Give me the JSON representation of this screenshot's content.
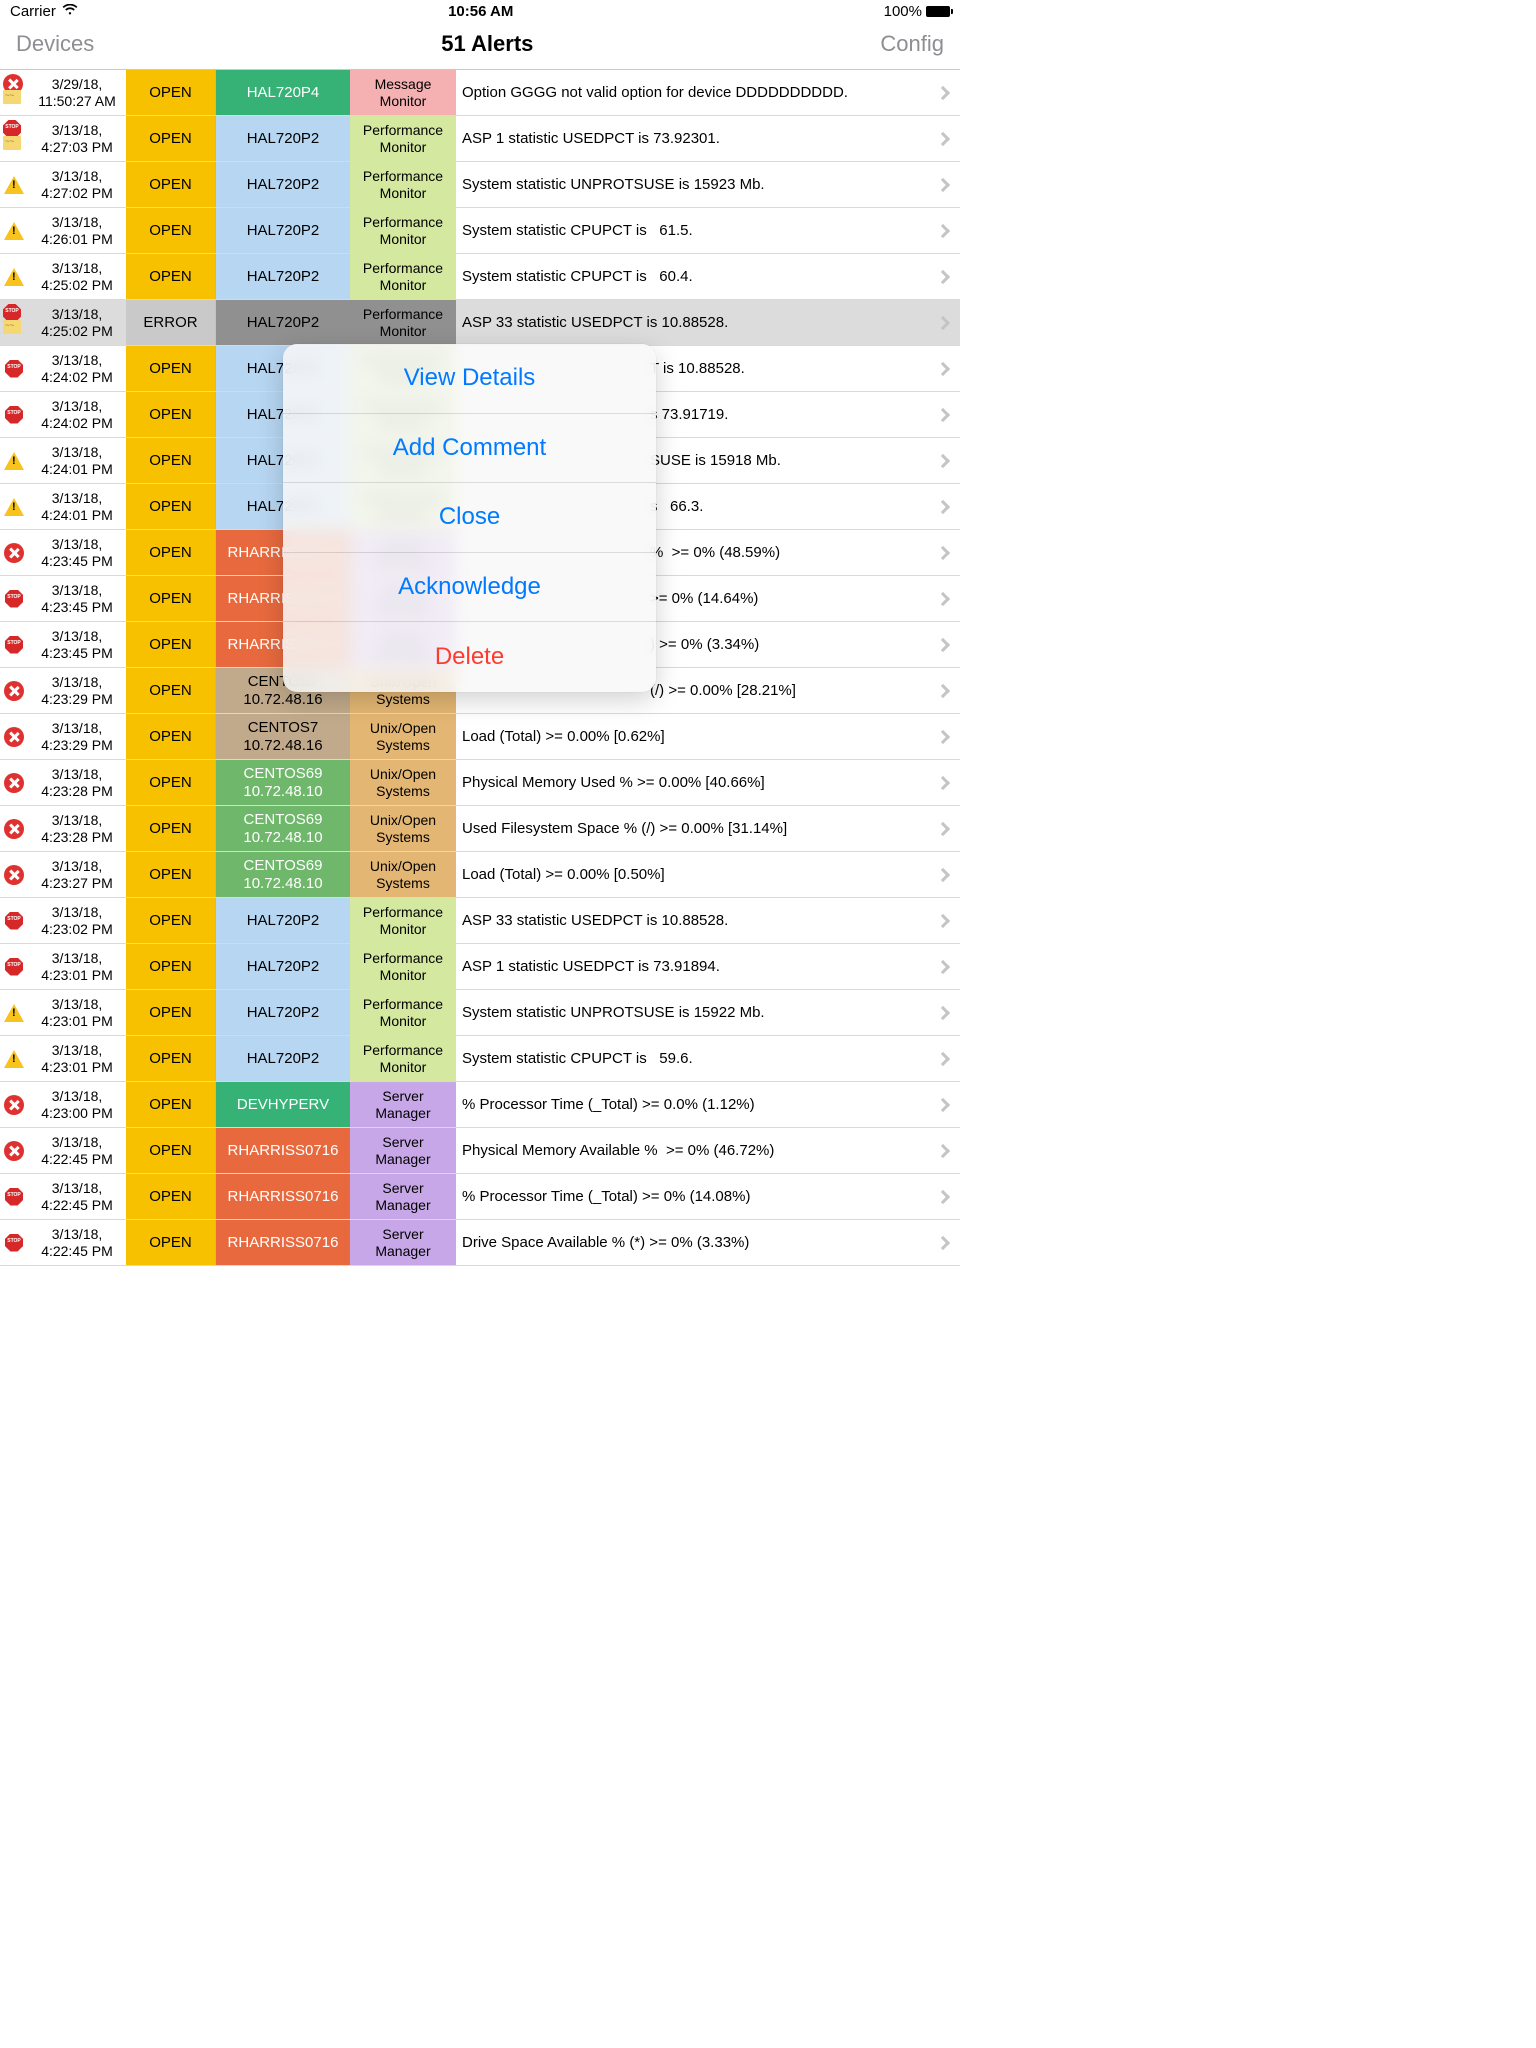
{
  "status_bar": {
    "carrier": "Carrier",
    "time": "10:56 AM",
    "battery": "100%"
  },
  "nav": {
    "left": "Devices",
    "title": "51 Alerts",
    "right": "Config"
  },
  "sheet": {
    "view_details": "View Details",
    "add_comment": "Add Comment",
    "close": "Close",
    "acknowledge": "Acknowledge",
    "delete": "Delete"
  },
  "rows": [
    {
      "icons": [
        "error",
        "note"
      ],
      "date": "3/29/18,",
      "time": "11:50:27 AM",
      "status": "OPEN",
      "sc": "yellow",
      "host": "HAL720P4",
      "hc": "green",
      "mon": "Message Monitor",
      "mc": "pink",
      "msg": "Option GGGG not valid option for device DDDDDDDDDD."
    },
    {
      "icons": [
        "stop",
        "note"
      ],
      "date": "3/13/18,",
      "time": "4:27:03 PM",
      "status": "OPEN",
      "sc": "yellow",
      "host": "HAL720P2",
      "hc": "lblue",
      "mon": "Performance Monitor",
      "mc": "pgreen",
      "msg": "ASP 1 statistic USEDPCT is 73.92301."
    },
    {
      "icons": [
        "warn"
      ],
      "date": "3/13/18,",
      "time": "4:27:02 PM",
      "status": "OPEN",
      "sc": "yellow",
      "host": "HAL720P2",
      "hc": "lblue",
      "mon": "Performance Monitor",
      "mc": "pgreen",
      "msg": "System statistic UNPROTSUSE is 15923 Mb."
    },
    {
      "icons": [
        "warn"
      ],
      "date": "3/13/18,",
      "time": "4:26:01 PM",
      "status": "OPEN",
      "sc": "yellow",
      "host": "HAL720P2",
      "hc": "lblue",
      "mon": "Performance Monitor",
      "mc": "pgreen",
      "msg": "System statistic CPUPCT is   61.5."
    },
    {
      "icons": [
        "warn"
      ],
      "date": "3/13/18,",
      "time": "4:25:02 PM",
      "status": "OPEN",
      "sc": "yellow",
      "host": "HAL720P2",
      "hc": "lblue",
      "mon": "Performance Monitor",
      "mc": "pgreen",
      "msg": "System statistic CPUPCT is   60.4."
    },
    {
      "icons": [
        "stop",
        "note"
      ],
      "date": "3/13/18,",
      "time": "4:25:02 PM",
      "status": "ERROR",
      "sc": "errgray",
      "host": "HAL720P2",
      "hc": "gray",
      "mon": "Performance Monitor",
      "mc": "gray",
      "msg": "ASP 33 statistic USEDPCT is 10.88528.",
      "rowc": "error"
    },
    {
      "icons": [
        "stop"
      ],
      "date": "3/13/18,",
      "time": "4:24:02 PM",
      "status": "OPEN",
      "sc": "yellow",
      "host": "HAL720P2",
      "hc": "lblue",
      "mon": "Performance Monitor",
      "mc": "pgreen",
      "msg": "T is 10.88528.",
      "msgpad": true
    },
    {
      "icons": [
        "stop"
      ],
      "date": "3/13/18,",
      "time": "4:24:02 PM",
      "status": "OPEN",
      "sc": "yellow",
      "host": "HAL720P2",
      "hc": "lblue",
      "mon": "Performance Monitor",
      "mc": "pgreen",
      "msg": "s 73.91719.",
      "msgpad": true
    },
    {
      "icons": [
        "warn"
      ],
      "date": "3/13/18,",
      "time": "4:24:01 PM",
      "status": "OPEN",
      "sc": "yellow",
      "host": "HAL720P2",
      "hc": "lblue",
      "mon": "Performance Monitor",
      "mc": "pgreen",
      "msg": "SUSE is 15918 Mb.",
      "msgpad": true
    },
    {
      "icons": [
        "warn"
      ],
      "date": "3/13/18,",
      "time": "4:24:01 PM",
      "status": "OPEN",
      "sc": "yellow",
      "host": "HAL720P2",
      "hc": "lblue",
      "mon": "Performance Monitor",
      "mc": "pgreen",
      "msg": "s   66.3.",
      "msgpad": true
    },
    {
      "icons": [
        "error"
      ],
      "date": "3/13/18,",
      "time": "4:23:45 PM",
      "status": "OPEN",
      "sc": "yellow",
      "host": "RHARRISS0716",
      "hc": "orange",
      "mon": "Server Manager",
      "mc": "purple",
      "msg": "%  >= 0% (48.59%)",
      "msgpad": true
    },
    {
      "icons": [
        "stop"
      ],
      "date": "3/13/18,",
      "time": "4:23:45 PM",
      "status": "OPEN",
      "sc": "yellow",
      "host": "RHARRISS0716",
      "hc": "orange",
      "mon": "Server Manager",
      "mc": "purple",
      "msg": ">= 0% (14.64%)",
      "msgpad": true
    },
    {
      "icons": [
        "stop"
      ],
      "date": "3/13/18,",
      "time": "4:23:45 PM",
      "status": "OPEN",
      "sc": "yellow",
      "host": "RHARRISS0716",
      "hc": "orange",
      "mon": "Server Manager",
      "mc": "purple",
      "msg": ") >= 0% (3.34%)",
      "msgpad": true
    },
    {
      "icons": [
        "error"
      ],
      "date": "3/13/18,",
      "time": "4:23:29 PM",
      "status": "OPEN",
      "sc": "yellow",
      "host": "CENTOS7",
      "host2": "10.72.48.16",
      "hc": "tan",
      "mon": "Unix/Open Systems",
      "mc": "mango",
      "msg": "(/) >= 0.00% [28.21%]",
      "msgpad": true
    },
    {
      "icons": [
        "error"
      ],
      "date": "3/13/18,",
      "time": "4:23:29 PM",
      "status": "OPEN",
      "sc": "yellow",
      "host": "CENTOS7",
      "host2": "10.72.48.16",
      "hc": "tan",
      "mon": "Unix/Open Systems",
      "mc": "mango",
      "msg": "Load (Total) >= 0.00% [0.62%]"
    },
    {
      "icons": [
        "error"
      ],
      "date": "3/13/18,",
      "time": "4:23:28 PM",
      "status": "OPEN",
      "sc": "yellow",
      "host": "CENTOS69",
      "host2": "10.72.48.10",
      "hc": "grass",
      "mon": "Unix/Open Systems",
      "mc": "mango",
      "msg": "Physical Memory Used % >= 0.00% [40.66%]"
    },
    {
      "icons": [
        "error"
      ],
      "date": "3/13/18,",
      "time": "4:23:28 PM",
      "status": "OPEN",
      "sc": "yellow",
      "host": "CENTOS69",
      "host2": "10.72.48.10",
      "hc": "grass",
      "mon": "Unix/Open Systems",
      "mc": "mango",
      "msg": "Used Filesystem Space % (/) >= 0.00% [31.14%]"
    },
    {
      "icons": [
        "error"
      ],
      "date": "3/13/18,",
      "time": "4:23:27 PM",
      "status": "OPEN",
      "sc": "yellow",
      "host": "CENTOS69",
      "host2": "10.72.48.10",
      "hc": "grass",
      "mon": "Unix/Open Systems",
      "mc": "mango",
      "msg": "Load (Total) >= 0.00% [0.50%]"
    },
    {
      "icons": [
        "stop"
      ],
      "date": "3/13/18,",
      "time": "4:23:02 PM",
      "status": "OPEN",
      "sc": "yellow",
      "host": "HAL720P2",
      "hc": "lblue",
      "mon": "Performance Monitor",
      "mc": "pgreen",
      "msg": "ASP 33 statistic USEDPCT is 10.88528."
    },
    {
      "icons": [
        "stop"
      ],
      "date": "3/13/18,",
      "time": "4:23:01 PM",
      "status": "OPEN",
      "sc": "yellow",
      "host": "HAL720P2",
      "hc": "lblue",
      "mon": "Performance Monitor",
      "mc": "pgreen",
      "msg": "ASP 1 statistic USEDPCT is 73.91894."
    },
    {
      "icons": [
        "warn"
      ],
      "date": "3/13/18,",
      "time": "4:23:01 PM",
      "status": "OPEN",
      "sc": "yellow",
      "host": "HAL720P2",
      "hc": "lblue",
      "mon": "Performance Monitor",
      "mc": "pgreen",
      "msg": "System statistic UNPROTSUSE is 15922 Mb."
    },
    {
      "icons": [
        "warn"
      ],
      "date": "3/13/18,",
      "time": "4:23:01 PM",
      "status": "OPEN",
      "sc": "yellow",
      "host": "HAL720P2",
      "hc": "lblue",
      "mon": "Performance Monitor",
      "mc": "pgreen",
      "msg": "System statistic CPUPCT is   59.6."
    },
    {
      "icons": [
        "error"
      ],
      "date": "3/13/18,",
      "time": "4:23:00 PM",
      "status": "OPEN",
      "sc": "yellow",
      "host": "DEVHYPERV",
      "hc": "green",
      "mon": "Server Manager",
      "mc": "purple",
      "msg": "% Processor Time (_Total) >= 0.0% (1.12%)"
    },
    {
      "icons": [
        "error"
      ],
      "date": "3/13/18,",
      "time": "4:22:45 PM",
      "status": "OPEN",
      "sc": "yellow",
      "host": "RHARRISS0716",
      "hc": "orange",
      "mon": "Server Manager",
      "mc": "purple",
      "msg": "Physical Memory Available %  >= 0% (46.72%)"
    },
    {
      "icons": [
        "stop"
      ],
      "date": "3/13/18,",
      "time": "4:22:45 PM",
      "status": "OPEN",
      "sc": "yellow",
      "host": "RHARRISS0716",
      "hc": "orange",
      "mon": "Server Manager",
      "mc": "purple",
      "msg": "% Processor Time (_Total) >= 0% (14.08%)"
    },
    {
      "icons": [
        "stop"
      ],
      "date": "3/13/18,",
      "time": "4:22:45 PM",
      "status": "OPEN",
      "sc": "yellow",
      "host": "RHARRISS0716",
      "hc": "orange",
      "mon": "Server Manager",
      "mc": "purple",
      "msg": "Drive Space Available % (*) >= 0% (3.33%)"
    }
  ]
}
